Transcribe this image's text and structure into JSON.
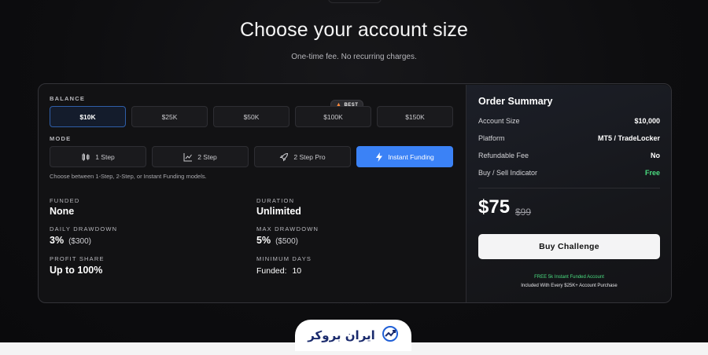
{
  "header": {
    "title": "Choose your account size",
    "subtitle": "One-time fee. No recurring charges."
  },
  "balance": {
    "label": "BALANCE",
    "badge": "BEST",
    "options": [
      "$10K",
      "$25K",
      "$50K",
      "$100K",
      "$150K"
    ],
    "selected": "$10K"
  },
  "mode": {
    "label": "MODE",
    "options": [
      "1 Step",
      "2 Step",
      "2 Step Pro",
      "Instant Funding"
    ],
    "selected": "Instant Funding",
    "hint": "Choose between 1-Step, 2-Step, or Instant Funding models."
  },
  "stats": {
    "funded_label": "FUNDED",
    "funded_value": "None",
    "duration_label": "DURATION",
    "duration_value": "Unlimited",
    "daily_dd_label": "DAILY DRAWDOWN",
    "daily_dd_value": "3%",
    "daily_dd_sub": "($300)",
    "max_dd_label": "MAX DRAWDOWN",
    "max_dd_value": "5%",
    "max_dd_sub": "($500)",
    "profit_label": "PROFIT SHARE",
    "profit_value": "Up to 100%",
    "min_days_label": "MINIMUM DAYS",
    "min_days_prefix": "Funded:",
    "min_days_value": "10"
  },
  "summary": {
    "title": "Order Summary",
    "rows": [
      {
        "label": "Account Size",
        "value": "$10,000"
      },
      {
        "label": "Platform",
        "value": "MT5 / TradeLocker"
      },
      {
        "label": "Refundable Fee",
        "value": "No"
      },
      {
        "label": "Buy / Sell Indicator",
        "value": "Free"
      }
    ],
    "price": "$75",
    "old_price": "$99",
    "buy_label": "Buy Challenge",
    "promo_line1": "FREE 5k Instant Funded Account",
    "promo_line2": "Included With Every $25K+ Account Purchase"
  },
  "brand": {
    "logo_text": "ایران بروکر"
  },
  "colors": {
    "accent": "#3b82f6",
    "free": "#4ade80",
    "background": "#0d0d0f"
  }
}
